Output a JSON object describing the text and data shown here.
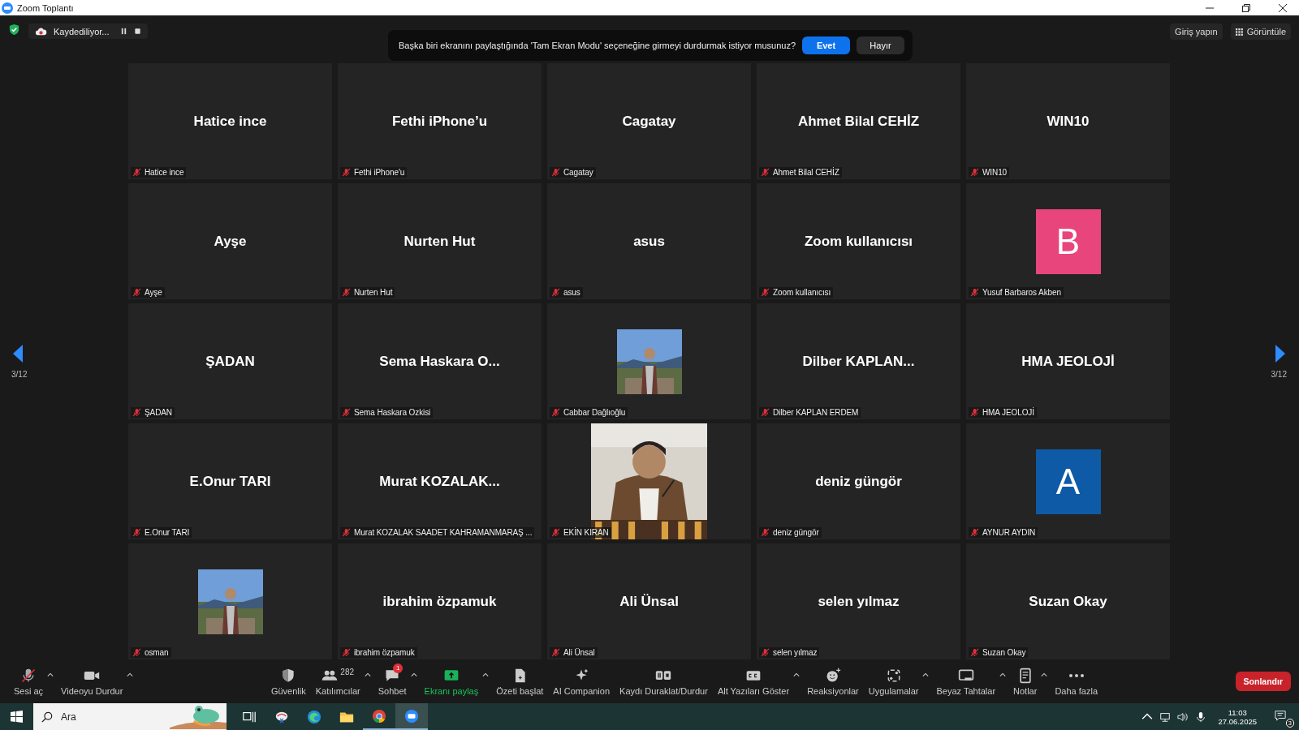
{
  "window": {
    "title": "Zoom Toplantı"
  },
  "top_bar": {
    "recording": "Kaydediliyor...",
    "sign_in": "Giriş yapın",
    "view": "Görüntüle"
  },
  "prompt": {
    "message": "Başka biri ekranını paylaştığında 'Tam Ekran Modu' seçeneğine girmeyi durdurmak istiyor musunuz?",
    "yes": "Evet",
    "no": "Hayır"
  },
  "pager": {
    "left": "3/12",
    "right": "3/12"
  },
  "tiles": [
    {
      "kind": "name",
      "display": "Hatice ince",
      "label": "Hatice ince"
    },
    {
      "kind": "name",
      "display": "Fethi iPhone’u",
      "label": "Fethi iPhone'u"
    },
    {
      "kind": "name",
      "display": "Cagatay",
      "label": "Cagatay"
    },
    {
      "kind": "name",
      "display": "Ahmet Bilal CEHİZ",
      "label": "Ahmet Bilal CEHİZ"
    },
    {
      "kind": "name",
      "display": "WIN10",
      "label": "WIN10"
    },
    {
      "kind": "name",
      "display": "Ayşe",
      "label": "Ayşe"
    },
    {
      "kind": "name",
      "display": "Nurten Hut",
      "label": "Nurten Hut"
    },
    {
      "kind": "name",
      "display": "asus",
      "label": "asus"
    },
    {
      "kind": "name",
      "display": "Zoom kullanıcısı",
      "label": "Zoom kullanıcısı"
    },
    {
      "kind": "avatar",
      "display": "B",
      "color": "#e8457c",
      "label": "Yusuf Barbaros Akben"
    },
    {
      "kind": "name",
      "display": "ŞADAN",
      "label": "ŞADAN"
    },
    {
      "kind": "name",
      "display": "Sema Haskara O...",
      "label": "Sema Haskara Ozkisi"
    },
    {
      "label": "Cabbar Dağlıoğlu"
    },
    {
      "kind": "name",
      "display": "Dilber  KAPLAN...",
      "label": "Dilber KAPLAN ERDEM"
    },
    {
      "kind": "name",
      "display": "HMA JEOLOJİ",
      "label": "HMA JEOLOJİ"
    },
    {
      "kind": "name",
      "display": "E.Onur TARI",
      "label": "E.Onur TARI"
    },
    {
      "kind": "name",
      "display": "Murat  KOZALAK...",
      "label": "Murat KOZALAK SAADET KAHRAMANMARAŞ ..."
    },
    {
      "kind": "video",
      "label": "EKİN KIRAN"
    },
    {
      "kind": "name",
      "display": "deniz güngör",
      "label": "deniz güngör"
    },
    {
      "kind": "avatar",
      "display": "A",
      "color": "#0e5aa7",
      "label": "AYNUR AYDIN"
    },
    {
      "label": "osman"
    },
    {
      "kind": "name",
      "display": "ibrahim özpamuk",
      "label": "ibrahim özpamuk"
    },
    {
      "kind": "name",
      "display": "Ali Ünsal",
      "label": "Ali Ünsal"
    },
    {
      "kind": "name",
      "display": "selen yılmaz",
      "label": "selen yılmaz"
    },
    {
      "kind": "name",
      "display": "Suzan Okay",
      "label": "Suzan Okay"
    }
  ],
  "toolbar_left": [
    {
      "label": "Sesi aç",
      "caret": true
    },
    {
      "label": "Videoyu Durdur",
      "caret": true
    }
  ],
  "toolbar": [
    {
      "label": "Güvenlik"
    },
    {
      "label": "Katılımcılar",
      "count": "282",
      "caret": true
    },
    {
      "label": "Sohbet",
      "badge": "1",
      "caret": true
    },
    {
      "label": "Ekranı paylaş",
      "caret": true,
      "highlight": true
    },
    {
      "label": "Özeti başlat"
    },
    {
      "label": "AI Companion"
    },
    {
      "label": "Kaydı Duraklat/Durdur"
    },
    {
      "label": "Alt Yazıları Göster",
      "caret": true
    },
    {
      "label": "Reaksiyonlar"
    },
    {
      "label": "Uygulamalar",
      "caret": true
    },
    {
      "label": "Beyaz Tahtalar",
      "caret": true
    },
    {
      "label": "Notlar",
      "caret": true
    },
    {
      "label": "Daha fazla"
    }
  ],
  "end_button": "Sonlandır",
  "taskbar": {
    "search_placeholder": "Ara",
    "time": "11:03",
    "date": "27.06.2025",
    "notifications": "3"
  }
}
